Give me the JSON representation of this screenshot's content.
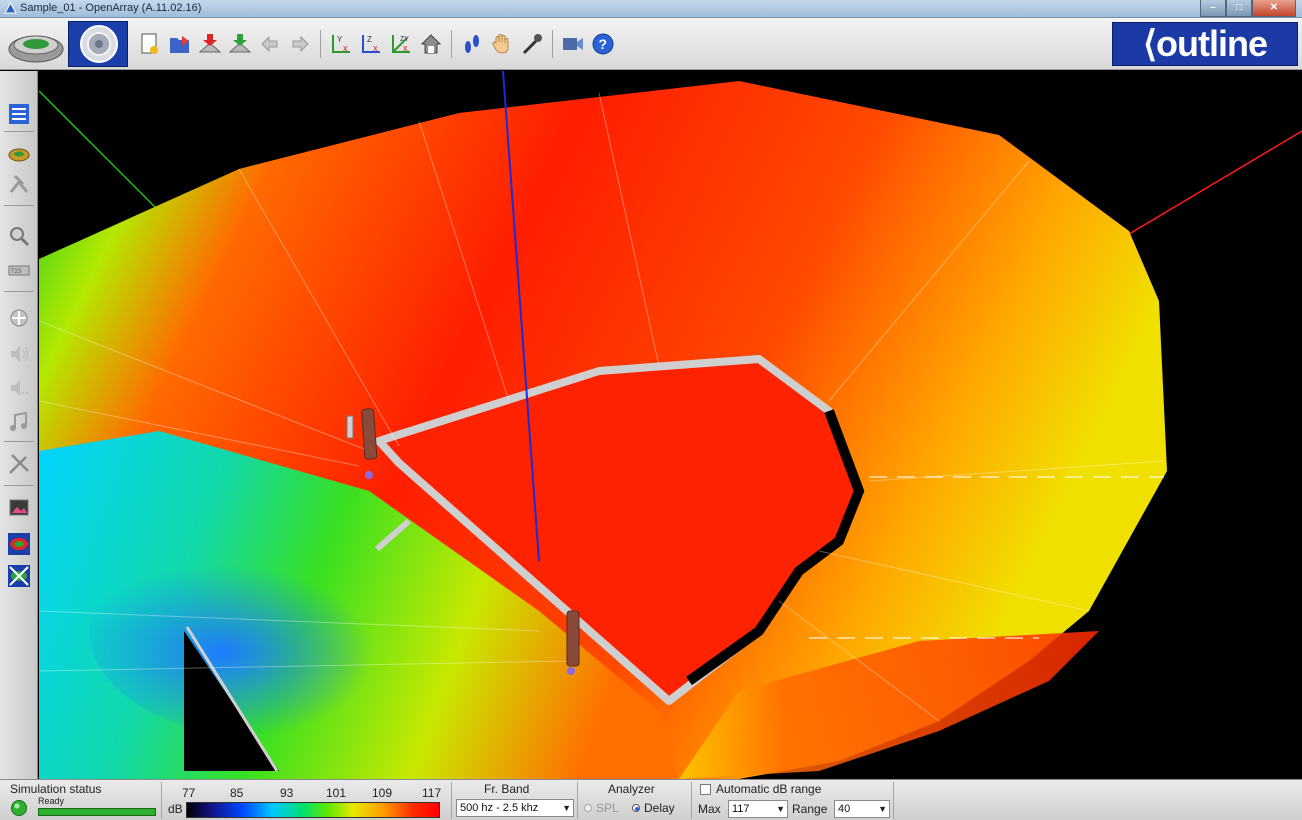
{
  "window": {
    "title": "Sample_01 - OpenArray (A.11.02.16)"
  },
  "brand": {
    "logo_text": "⟨outline"
  },
  "toolbar_icons": [
    "new-project-icon",
    "open-icon",
    "save-icon",
    "export-icon",
    "undo-icon",
    "redo-icon",
    "axis-yx-icon",
    "axis-zx-icon",
    "axis-zyx-icon",
    "home-view-icon",
    "walk-icon",
    "pan-hand-icon",
    "microphone-icon",
    "camera-icon",
    "help-icon"
  ],
  "sidebar_icons": [
    "list-view-icon",
    "stadium-icon",
    "speaker-hang-icon",
    "zoom-icon",
    "array-icon",
    "move-icon",
    "speaker-on-icon",
    "speaker-off-icon",
    "music-note-icon",
    "tools-icon",
    "image-icon",
    "spl-map-icon",
    "no-map-icon"
  ],
  "status": {
    "simulation_label": "Simulation status",
    "simulation_value": "Ready",
    "db_unit": "dB",
    "scale_ticks": [
      "77",
      "85",
      "93",
      "101",
      "109",
      "117"
    ],
    "band_label": "Fr. Band",
    "band_value": "500 hz - 2.5 khz",
    "analyzer_label": "Analyzer",
    "analyzer_spl": "SPL",
    "analyzer_delay": "Delay",
    "analyzer_selected": "Delay",
    "auto_range_label": "Automatic dB range",
    "auto_range_checked": false,
    "max_label": "Max",
    "max_value": "117",
    "range_label": "Range",
    "range_value": "40"
  },
  "colors": {
    "accent": "#1c3aa6",
    "status_ok": "#2fb12f"
  }
}
